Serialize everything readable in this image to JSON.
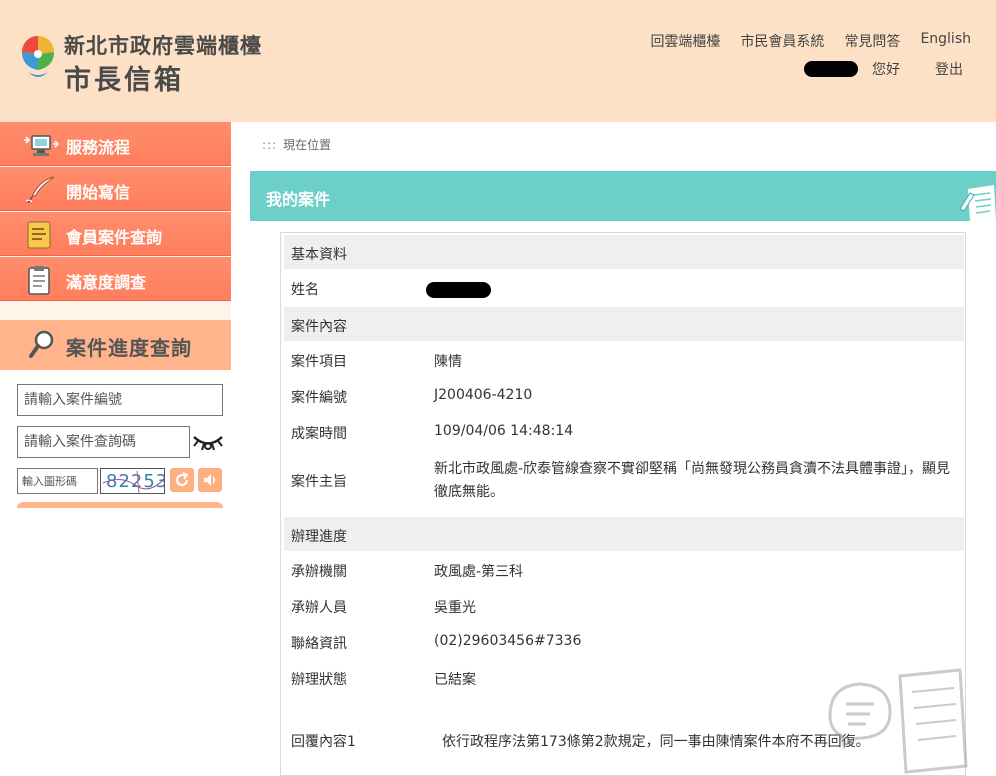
{
  "header": {
    "logo_line1": "新北市政府雲端櫃檯",
    "logo_line2": "市長信箱",
    "nav": [
      "回雲端櫃檯",
      "市民會員系統",
      "常見問答",
      "English"
    ],
    "greeting": "您好",
    "logout": "登出"
  },
  "sidebar": {
    "menu": [
      {
        "label": "服務流程",
        "icon": "computer-icon"
      },
      {
        "label": "開始寫信",
        "icon": "quill-icon"
      },
      {
        "label": "會員案件查詢",
        "icon": "folder-icon"
      },
      {
        "label": "滿意度調查",
        "icon": "clipboard-icon"
      }
    ],
    "progress_title": "案件進度查詢",
    "case_no_placeholder": "請輸入案件編號",
    "case_pwd_placeholder": "請輸入案件查詢碼",
    "captcha_placeholder": "輸入圖形碼",
    "captcha_code": "82253"
  },
  "main": {
    "breadcrumb_dots": ":::",
    "breadcrumb": "現在位置",
    "page_title": "我的案件",
    "basic": {
      "title": "基本資料",
      "name_label": "姓名"
    },
    "case": {
      "title": "案件內容",
      "rows": [
        {
          "label": "案件項目",
          "value": "陳情"
        },
        {
          "label": "案件編號",
          "value": "J200406-4210"
        },
        {
          "label": "成案時間",
          "value": "109/04/06 14:48:14"
        },
        {
          "label": "案件主旨",
          "value": "新北市政風處-欣泰管線查察不實卻堅稱「尚無發現公務員貪瀆不法具體事證」，顯見徹底無能。"
        }
      ]
    },
    "progress": {
      "title": "辦理進度",
      "rows": [
        {
          "label": "承辦機關",
          "value": "政風處-第三科"
        },
        {
          "label": "承辦人員",
          "value": "吳重光"
        },
        {
          "label": "聯絡資訊",
          "value": "(02)29603456#7336"
        },
        {
          "label": "辦理狀態",
          "value": "已結案"
        }
      ],
      "reply_label": "回覆內容1",
      "reply_value": "依行政程序法第173條第2款規定，同一事由陳情案件本府不再回復。"
    }
  },
  "colors": {
    "header_bg": "#fde1c6",
    "menu_bg": "#ff8e6e",
    "title_bar": "#6dd0c8",
    "section_bg": "#efefef"
  }
}
